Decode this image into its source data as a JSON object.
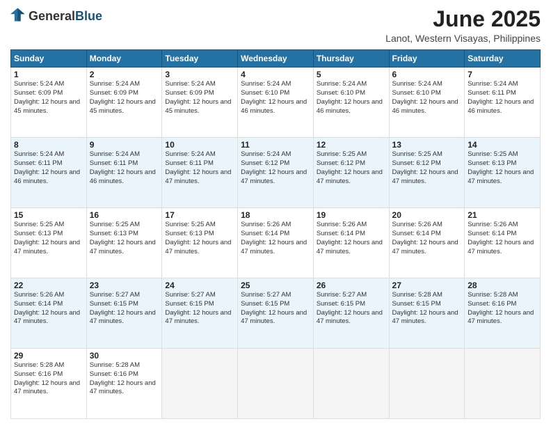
{
  "header": {
    "logo_general": "General",
    "logo_blue": "Blue",
    "month_title": "June 2025",
    "location": "Lanot, Western Visayas, Philippines"
  },
  "weekdays": [
    "Sunday",
    "Monday",
    "Tuesday",
    "Wednesday",
    "Thursday",
    "Friday",
    "Saturday"
  ],
  "weeks": [
    [
      {
        "day": "1",
        "sunrise": "5:24 AM",
        "sunset": "6:09 PM",
        "daylight": "12 hours and 45 minutes."
      },
      {
        "day": "2",
        "sunrise": "5:24 AM",
        "sunset": "6:09 PM",
        "daylight": "12 hours and 45 minutes."
      },
      {
        "day": "3",
        "sunrise": "5:24 AM",
        "sunset": "6:09 PM",
        "daylight": "12 hours and 45 minutes."
      },
      {
        "day": "4",
        "sunrise": "5:24 AM",
        "sunset": "6:10 PM",
        "daylight": "12 hours and 46 minutes."
      },
      {
        "day": "5",
        "sunrise": "5:24 AM",
        "sunset": "6:10 PM",
        "daylight": "12 hours and 46 minutes."
      },
      {
        "day": "6",
        "sunrise": "5:24 AM",
        "sunset": "6:10 PM",
        "daylight": "12 hours and 46 minutes."
      },
      {
        "day": "7",
        "sunrise": "5:24 AM",
        "sunset": "6:11 PM",
        "daylight": "12 hours and 46 minutes."
      }
    ],
    [
      {
        "day": "8",
        "sunrise": "5:24 AM",
        "sunset": "6:11 PM",
        "daylight": "12 hours and 46 minutes."
      },
      {
        "day": "9",
        "sunrise": "5:24 AM",
        "sunset": "6:11 PM",
        "daylight": "12 hours and 46 minutes."
      },
      {
        "day": "10",
        "sunrise": "5:24 AM",
        "sunset": "6:11 PM",
        "daylight": "12 hours and 47 minutes."
      },
      {
        "day": "11",
        "sunrise": "5:24 AM",
        "sunset": "6:12 PM",
        "daylight": "12 hours and 47 minutes."
      },
      {
        "day": "12",
        "sunrise": "5:25 AM",
        "sunset": "6:12 PM",
        "daylight": "12 hours and 47 minutes."
      },
      {
        "day": "13",
        "sunrise": "5:25 AM",
        "sunset": "6:12 PM",
        "daylight": "12 hours and 47 minutes."
      },
      {
        "day": "14",
        "sunrise": "5:25 AM",
        "sunset": "6:13 PM",
        "daylight": "12 hours and 47 minutes."
      }
    ],
    [
      {
        "day": "15",
        "sunrise": "5:25 AM",
        "sunset": "6:13 PM",
        "daylight": "12 hours and 47 minutes."
      },
      {
        "day": "16",
        "sunrise": "5:25 AM",
        "sunset": "6:13 PM",
        "daylight": "12 hours and 47 minutes."
      },
      {
        "day": "17",
        "sunrise": "5:25 AM",
        "sunset": "6:13 PM",
        "daylight": "12 hours and 47 minutes."
      },
      {
        "day": "18",
        "sunrise": "5:26 AM",
        "sunset": "6:14 PM",
        "daylight": "12 hours and 47 minutes."
      },
      {
        "day": "19",
        "sunrise": "5:26 AM",
        "sunset": "6:14 PM",
        "daylight": "12 hours and 47 minutes."
      },
      {
        "day": "20",
        "sunrise": "5:26 AM",
        "sunset": "6:14 PM",
        "daylight": "12 hours and 47 minutes."
      },
      {
        "day": "21",
        "sunrise": "5:26 AM",
        "sunset": "6:14 PM",
        "daylight": "12 hours and 47 minutes."
      }
    ],
    [
      {
        "day": "22",
        "sunrise": "5:26 AM",
        "sunset": "6:14 PM",
        "daylight": "12 hours and 47 minutes."
      },
      {
        "day": "23",
        "sunrise": "5:27 AM",
        "sunset": "6:15 PM",
        "daylight": "12 hours and 47 minutes."
      },
      {
        "day": "24",
        "sunrise": "5:27 AM",
        "sunset": "6:15 PM",
        "daylight": "12 hours and 47 minutes."
      },
      {
        "day": "25",
        "sunrise": "5:27 AM",
        "sunset": "6:15 PM",
        "daylight": "12 hours and 47 minutes."
      },
      {
        "day": "26",
        "sunrise": "5:27 AM",
        "sunset": "6:15 PM",
        "daylight": "12 hours and 47 minutes."
      },
      {
        "day": "27",
        "sunrise": "5:28 AM",
        "sunset": "6:15 PM",
        "daylight": "12 hours and 47 minutes."
      },
      {
        "day": "28",
        "sunrise": "5:28 AM",
        "sunset": "6:16 PM",
        "daylight": "12 hours and 47 minutes."
      }
    ],
    [
      {
        "day": "29",
        "sunrise": "5:28 AM",
        "sunset": "6:16 PM",
        "daylight": "12 hours and 47 minutes."
      },
      {
        "day": "30",
        "sunrise": "5:28 AM",
        "sunset": "6:16 PM",
        "daylight": "12 hours and 47 minutes."
      },
      {
        "day": "",
        "sunrise": "",
        "sunset": "",
        "daylight": ""
      },
      {
        "day": "",
        "sunrise": "",
        "sunset": "",
        "daylight": ""
      },
      {
        "day": "",
        "sunrise": "",
        "sunset": "",
        "daylight": ""
      },
      {
        "day": "",
        "sunrise": "",
        "sunset": "",
        "daylight": ""
      },
      {
        "day": "",
        "sunrise": "",
        "sunset": "",
        "daylight": ""
      }
    ]
  ]
}
